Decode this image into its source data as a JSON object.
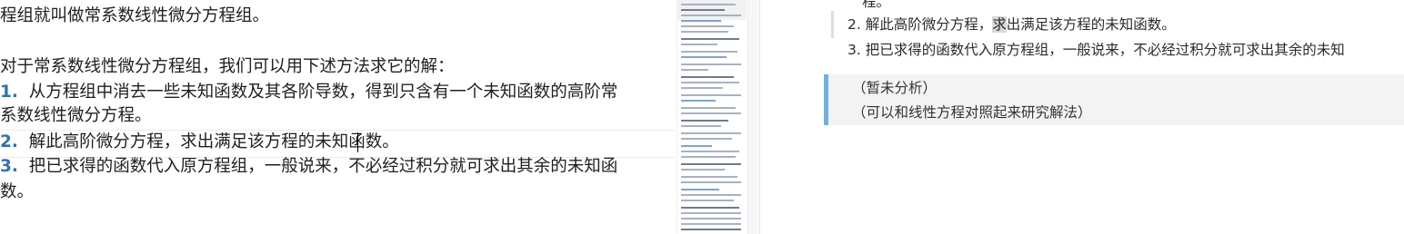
{
  "editor": {
    "lines": [
      {
        "num": "",
        "text": "程组就叫做常系数线性微分方程组。"
      },
      {
        "num": "",
        "text": "对于常系数线性微分方程组，我们可以用下述方法求它的解："
      },
      {
        "num": "1.",
        "text": "从方程组中消去一些未知函数及其各阶导数，得到只含有一个未知函数的高阶常"
      },
      {
        "num": "",
        "text": "系数线性微分方程。"
      },
      {
        "num": "2.",
        "text": "解此高阶微分方程，求出满足该方程的未知函数。"
      },
      {
        "num": "3.",
        "text": "把已求得的函数代入原方程组，一般说来，不必经过积分就可求出其余的未知函"
      },
      {
        "num": "",
        "text": "数。"
      }
    ]
  },
  "preview": {
    "top_fragment": "程。",
    "item2_prefix": "2. 解此高阶微分方程，",
    "item2_highlight": "求",
    "item2_suffix": "出满足该方程的未知函数。",
    "item3": "3. 把已求得的函数代入原方程组，一般说来，不必经过积分就可求出其余的未知",
    "callout": {
      "line1": "（暂未分析）",
      "line2": "（可以和线性方程对照起来研究解法）",
      "border_color": "#6fb0dc"
    }
  },
  "colors": {
    "list_number": "#2f6fb8",
    "highlight": "#d9d9d9"
  }
}
